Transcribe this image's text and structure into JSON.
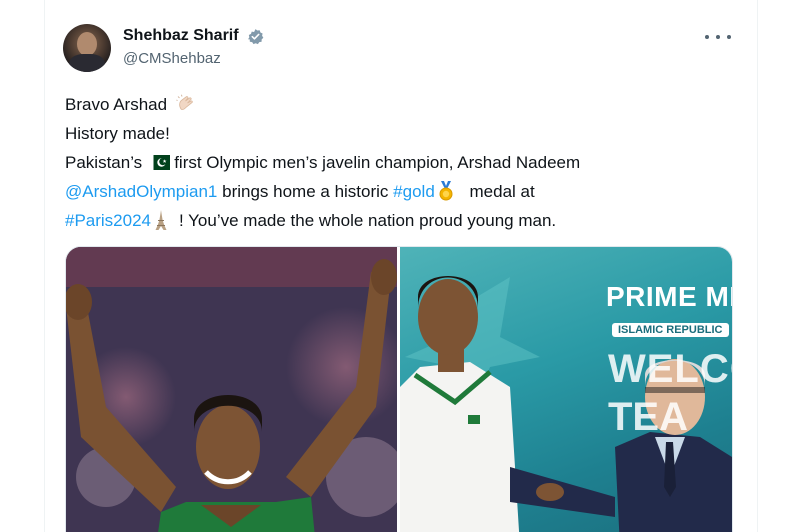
{
  "author": {
    "display_name": "Shehbaz Sharif",
    "handle": "@CMShehbaz",
    "verified": true
  },
  "menu": {
    "icon": "more-horizontal-icon"
  },
  "tweet": {
    "line1": "Bravo Arshad",
    "line2": "History made!",
    "line3_a": "Pakistan’s",
    "line3_b": "first Olympic men’s javelin champion, Arshad Nadeem",
    "mention": "@ArshadOlympian1",
    "line4_a": "brings home a historic",
    "hashtag_gold": "#gold",
    "line4_b": "medal at",
    "hashtag_paris": "#Paris2024",
    "line5": "! You’ve made the whole nation proud young man."
  },
  "media": {
    "banner_title": "PRIME MI",
    "banner_subtitle": "ISLAMIC REPUBLIC",
    "banner_welcome": "WELCO",
    "banner_team": "TEA"
  },
  "colors": {
    "link": "#1d9bf0",
    "text": "#0f1419",
    "secondary": "#536471",
    "verified": "#829aab"
  }
}
